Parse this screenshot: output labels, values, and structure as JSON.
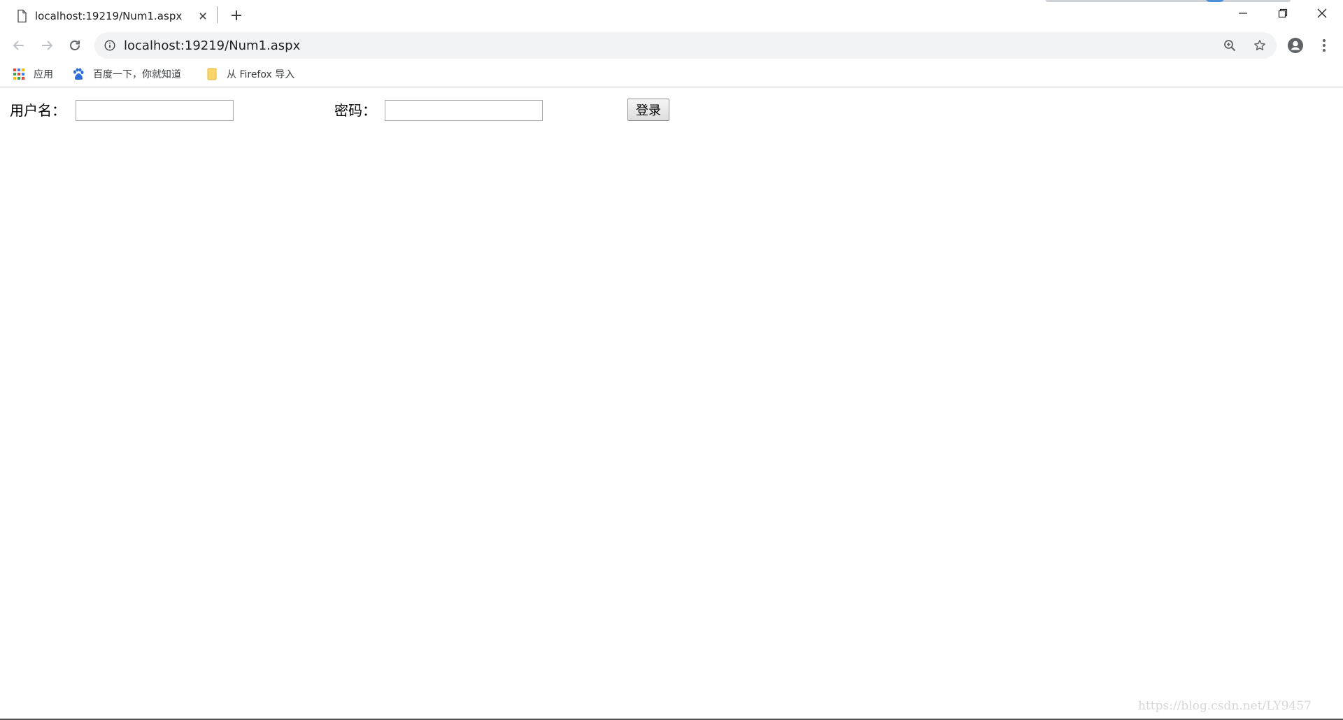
{
  "tab": {
    "title": "localhost:19219/Num1.aspx"
  },
  "toolbar": {
    "url": "localhost:19219/Num1.aspx"
  },
  "bookmarks": {
    "items": [
      {
        "label": "应用",
        "icon": "apps-grid-icon"
      },
      {
        "label": "百度一下，你就知道",
        "icon": "baidu-paw-icon"
      },
      {
        "label": "从 Firefox 导入",
        "icon": "folder-icon"
      }
    ]
  },
  "form": {
    "username_label": "用户名：",
    "username_value": "",
    "password_label": "密码：",
    "password_value": "",
    "login_button": "登录"
  },
  "watermark": "https://blog.csdn.net/LY9457",
  "colors": {
    "omnibox_bg": "#f1f3f4",
    "baidu_blue": "#2f6fd8",
    "folder_yellow": "#f9d56b"
  }
}
